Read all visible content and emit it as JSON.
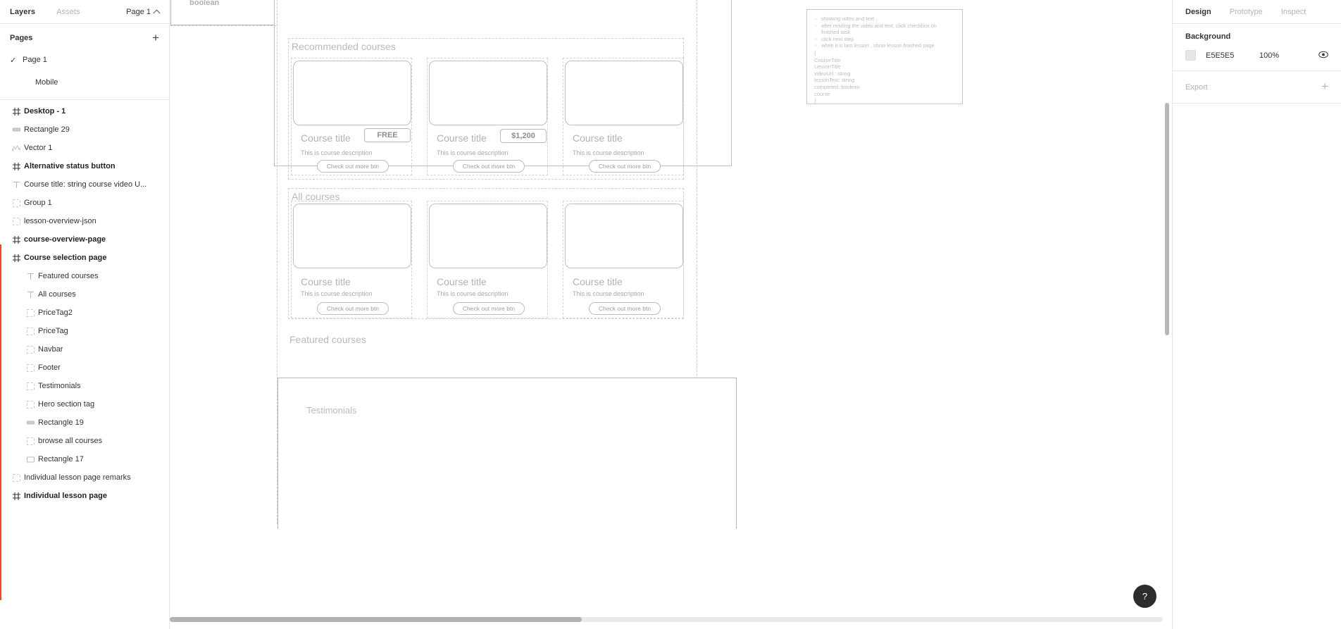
{
  "left_panel": {
    "tabs": [
      {
        "label": "Layers",
        "active": true
      },
      {
        "label": "Assets",
        "active": false
      }
    ],
    "page_selector": "Page 1",
    "pages_header": "Pages",
    "add_page_label": "+",
    "pages": [
      {
        "label": "Page 1",
        "selected": true
      },
      {
        "label": "Mobile",
        "selected": false
      }
    ],
    "layers": [
      {
        "label": "Desktop - 1",
        "icon": "frame-icon",
        "depth": 0,
        "bold": true
      },
      {
        "label": "Rectangle 29",
        "icon": "rectangle-icon",
        "depth": 0,
        "bold": false
      },
      {
        "label": "Vector 1",
        "icon": "vector-icon",
        "depth": 0,
        "bold": false
      },
      {
        "label": "Alternative status button",
        "icon": "frame-icon",
        "depth": 0,
        "bold": true
      },
      {
        "label": "Course title: string course video U...",
        "icon": "text-icon",
        "depth": 0,
        "bold": false
      },
      {
        "label": "Group 1",
        "icon": "group-icon",
        "depth": 0,
        "bold": false
      },
      {
        "label": "lesson-overview-json",
        "icon": "group-icon",
        "depth": 0,
        "bold": false
      },
      {
        "label": "course-overview-page",
        "icon": "frame-icon",
        "depth": 0,
        "bold": true
      },
      {
        "label": "Course selection page",
        "icon": "frame-icon",
        "depth": 0,
        "bold": true
      },
      {
        "label": "Featured courses",
        "icon": "text-icon",
        "depth": 1,
        "bold": false
      },
      {
        "label": "All courses",
        "icon": "text-icon",
        "depth": 1,
        "bold": false
      },
      {
        "label": "PriceTag2",
        "icon": "group-icon",
        "depth": 1,
        "bold": false
      },
      {
        "label": "PriceTag",
        "icon": "group-icon",
        "depth": 1,
        "bold": false
      },
      {
        "label": "Navbar",
        "icon": "group-icon",
        "depth": 1,
        "bold": false
      },
      {
        "label": "Footer",
        "icon": "group-icon",
        "depth": 1,
        "bold": false
      },
      {
        "label": "Testimonials",
        "icon": "group-icon",
        "depth": 1,
        "bold": false
      },
      {
        "label": "Hero section tag",
        "icon": "group-icon",
        "depth": 1,
        "bold": false
      },
      {
        "label": "Rectangle 19",
        "icon": "rectangle-icon",
        "depth": 1,
        "bold": false
      },
      {
        "label": "browse all courses",
        "icon": "group-icon",
        "depth": 1,
        "bold": false
      },
      {
        "label": "Rectangle 17",
        "icon": "rectangle-outline-icon",
        "depth": 1,
        "bold": false
      },
      {
        "label": "Individual lesson page remarks",
        "icon": "group-icon",
        "depth": 0,
        "bold": false
      },
      {
        "label": "Individual lesson page",
        "icon": "frame-icon",
        "depth": 0,
        "bold": true
      }
    ],
    "selection_accent_color": "#F24822"
  },
  "canvas": {
    "boolean_label": "boolean",
    "sections": {
      "recommended": "Recommended courses",
      "all": "All courses",
      "featured": "Featured courses",
      "testimonials": "Testimonials"
    },
    "recommended_cards": [
      {
        "title": "Course title",
        "desc": "This is course description",
        "button": "Check out more btn",
        "price": "FREE"
      },
      {
        "title": "Course title",
        "desc": "This is course description",
        "button": "Check out more btn",
        "price": "$1,200"
      },
      {
        "title": "Course title",
        "desc": "This is course description",
        "button": "Check out more btn",
        "price": null
      }
    ],
    "all_cards": [
      {
        "title": "Course title",
        "desc": "This is course description",
        "button": "Check out more btn"
      },
      {
        "title": "Course title",
        "desc": "This is course description",
        "button": "Check out more btn"
      },
      {
        "title": "Course title",
        "desc": "This is course description",
        "button": "Check out more btn"
      }
    ],
    "remarks": {
      "bullets": [
        "showing video and text ,",
        "after reading the video and text, click checkbox on finished task",
        "click next step",
        "when it is last lesson , show lesson finished page"
      ],
      "json_lines": [
        "{",
        "CourseTitle",
        "LessonTitle",
        "videoUrl : string",
        "lessonText: string",
        "completed: boolean",
        "course",
        "}"
      ]
    },
    "help_button": "?"
  },
  "right_panel": {
    "tabs": [
      {
        "label": "Design",
        "active": true
      },
      {
        "label": "Prototype",
        "active": false
      },
      {
        "label": "Inspect",
        "active": false
      }
    ],
    "background": {
      "header": "Background",
      "hex": "E5E5E5",
      "opacity": "100%",
      "swatch_color": "#E5E5E5"
    },
    "export": {
      "header": "Export",
      "add_label": "+"
    }
  }
}
